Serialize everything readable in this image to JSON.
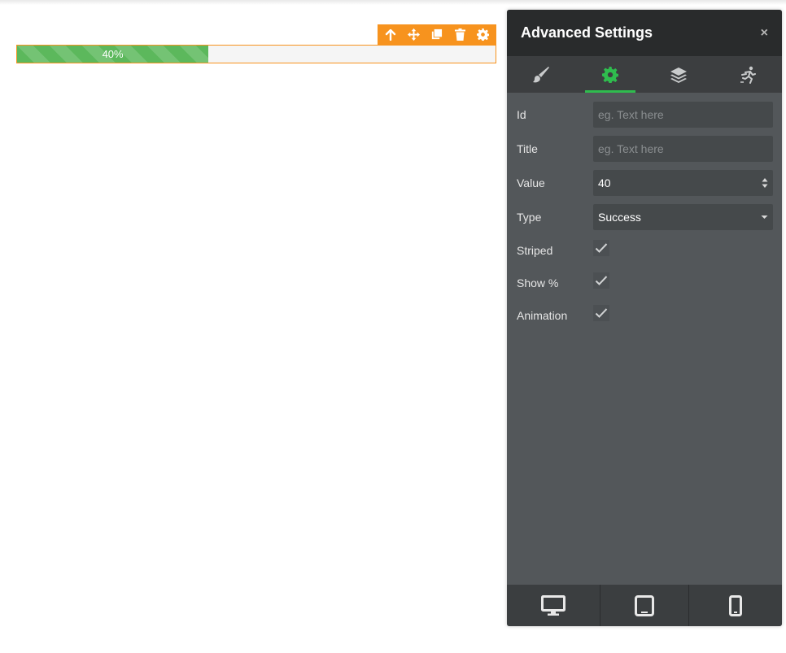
{
  "progress": {
    "value": 0.4,
    "label": "40%",
    "color": "#5cb85c",
    "toolbar_color": "#f7931e"
  },
  "toolbar": {
    "icons": [
      "arrow-up-icon",
      "move-icon",
      "duplicate-icon",
      "trash-icon",
      "gear-icon"
    ]
  },
  "panel": {
    "title": "Advanced Settings",
    "close_label": "×",
    "accent": "#2fbc4e",
    "tabs": [
      {
        "icon": "paintbrush-icon",
        "active": false
      },
      {
        "icon": "gear-icon",
        "active": true
      },
      {
        "icon": "layers-icon",
        "active": false
      },
      {
        "icon": "animation-figure-icon",
        "active": false
      }
    ],
    "fields": {
      "id": {
        "label": "Id",
        "placeholder": "eg. Text here",
        "value": ""
      },
      "title": {
        "label": "Title",
        "placeholder": "eg. Text here",
        "value": ""
      },
      "value": {
        "label": "Value",
        "value": "40"
      },
      "type": {
        "label": "Type",
        "selected": "Success"
      },
      "striped": {
        "label": "Striped",
        "checked": true
      },
      "show_percent": {
        "label": "Show %",
        "checked": true
      },
      "animation": {
        "label": "Animation",
        "checked": true
      }
    },
    "devices": [
      "desktop-icon",
      "tablet-icon",
      "mobile-icon"
    ]
  }
}
